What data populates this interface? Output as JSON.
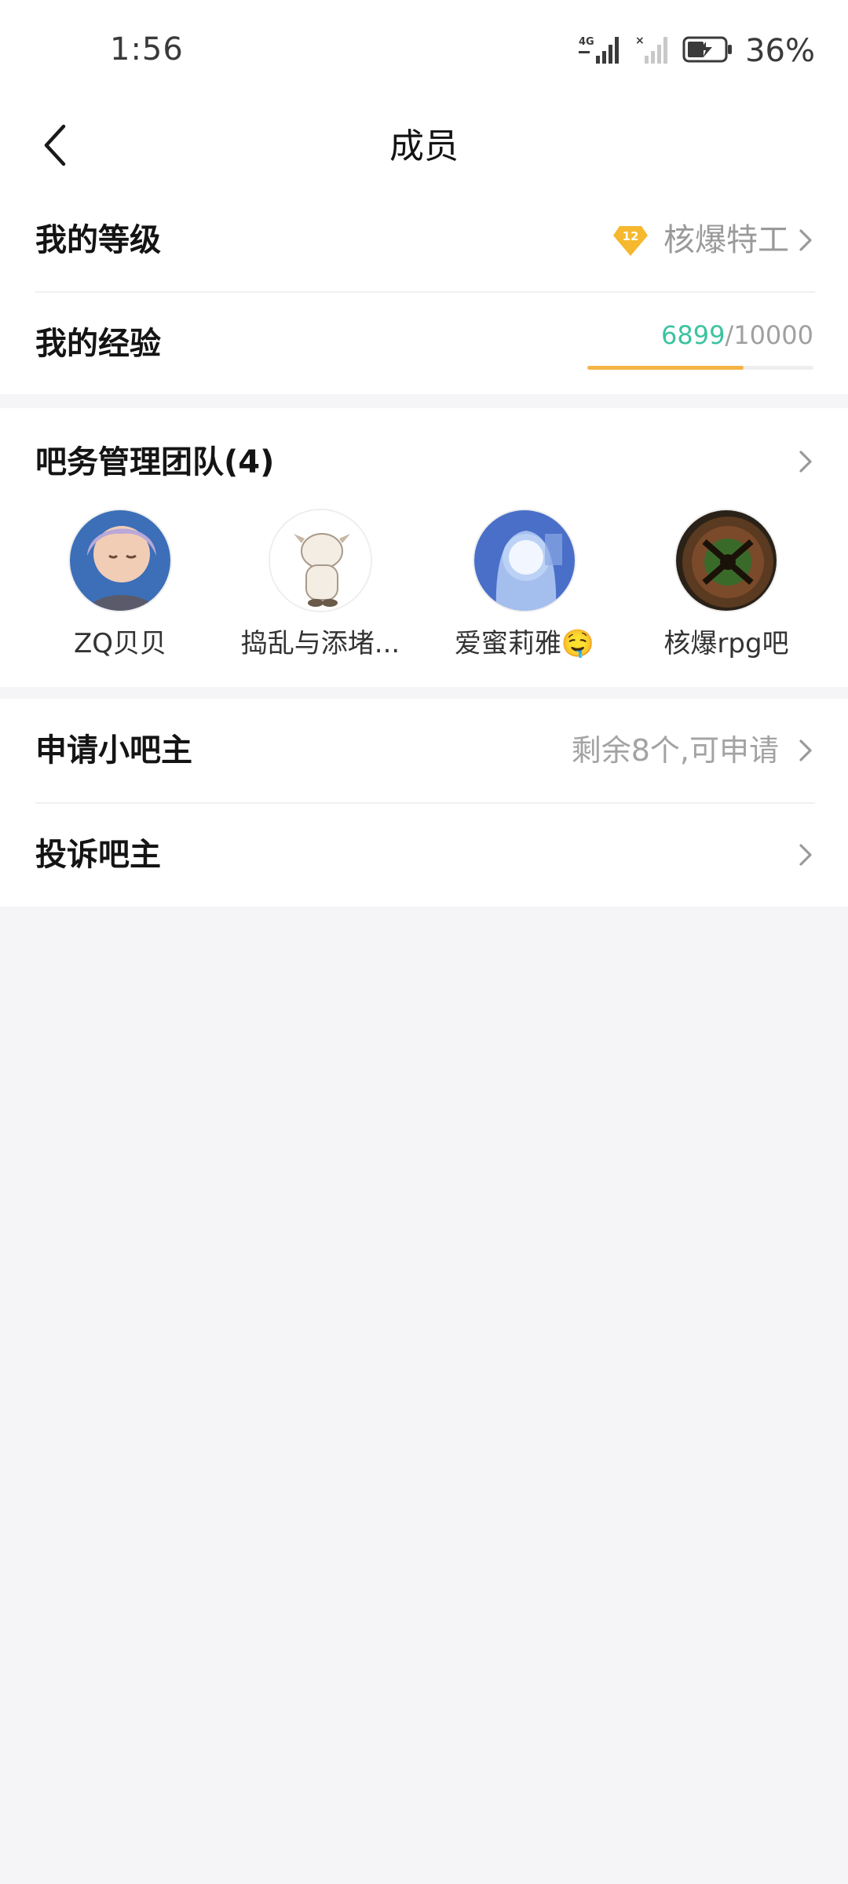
{
  "status_bar": {
    "time": "1:56",
    "network": "4G",
    "battery_text": "36%"
  },
  "header": {
    "title": "成员"
  },
  "level_row": {
    "label": "我的等级",
    "badge_level": "12",
    "level_name": "核爆特工"
  },
  "exp_row": {
    "label": "我的经验",
    "current": "6899",
    "separator_total": "/10000",
    "progress_fraction": 0.6899
  },
  "team": {
    "title": "吧务管理团队(4)",
    "members": [
      {
        "name": "ZQ贝贝"
      },
      {
        "name": "捣乱与添堵..."
      },
      {
        "name": "爱蜜莉雅🤤"
      },
      {
        "name": "核爆rpg吧"
      }
    ]
  },
  "apply_row": {
    "label": "申请小吧主",
    "sub": "剩余8个,可申请"
  },
  "complain_row": {
    "label": "投诉吧主"
  },
  "colors": {
    "accent_green": "#3cc3a0",
    "progress_orange": "#f5b443",
    "badge_gold": "#f5b82e",
    "background": "#f5f5f7"
  }
}
